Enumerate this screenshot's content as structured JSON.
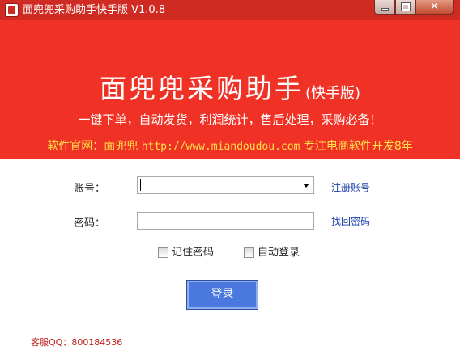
{
  "window": {
    "title": "面兜兜采购助手快手版 V1.0.8",
    "controls": {
      "minimize": "minimize",
      "maximize": "maximize",
      "close": "✕"
    },
    "icon": "app-logo-icon"
  },
  "banner": {
    "title_main": "面兜兜采购助手",
    "title_sub": "(快手版)",
    "tagline": "一键下单，自动发货，利润统计，售后处理，采购必备！",
    "official_prefix": "软件官网：面兜兜",
    "official_url": "http://www.miandoudou.com",
    "official_suffix": "专注电商软件开发8年"
  },
  "form": {
    "account_label": "账号：",
    "account_value": "",
    "register_link": "注册账号",
    "password_label": "密码：",
    "password_value": "",
    "recover_link": "找回密码",
    "remember_label": "记住密码",
    "remember_checked": false,
    "autologin_label": "自动登录",
    "autologin_checked": false,
    "login_button": "登录"
  },
  "footer": {
    "service": "客服QQ：800184536"
  },
  "colors": {
    "titlebar": "#cf2b22",
    "banner": "#f03226",
    "highlight_text": "#ffe14a",
    "link": "#1a3ea8",
    "login_button": "#4a78de",
    "service_text": "#c0201c"
  }
}
